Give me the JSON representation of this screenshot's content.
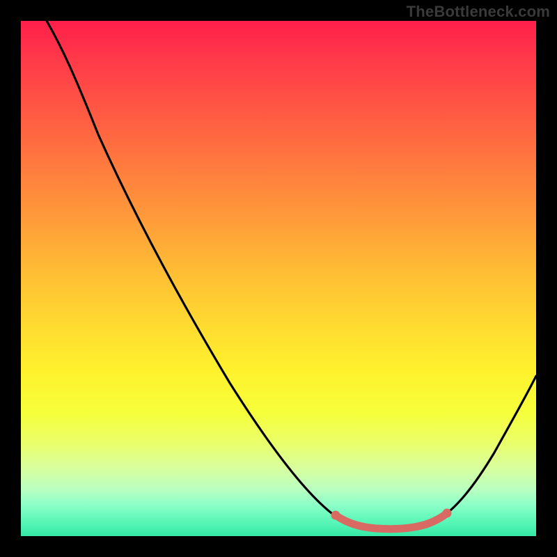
{
  "watermark": "TheBottleneck.com",
  "chart_data": {
    "type": "line",
    "title": "",
    "xlabel": "",
    "ylabel": "",
    "xlim": [
      0,
      100
    ],
    "ylim": [
      0,
      100
    ],
    "grid": false,
    "series": [
      {
        "name": "curve",
        "color": "#000000",
        "x": [
          5,
          10,
          15,
          20,
          25,
          30,
          35,
          40,
          45,
          50,
          55,
          60,
          63,
          66,
          70,
          74,
          78,
          81,
          83,
          86,
          90,
          95,
          100
        ],
        "y": [
          100,
          94,
          86,
          78,
          70,
          62,
          54,
          46,
          38,
          30,
          22,
          14,
          9,
          5.5,
          3,
          2,
          2,
          2.3,
          3,
          5,
          10,
          18,
          27
        ]
      },
      {
        "name": "highlight",
        "color": "#d86a63",
        "x": [
          63,
          65,
          67,
          69,
          71,
          73,
          75,
          77,
          79,
          81,
          83
        ],
        "y": [
          3.2,
          2.6,
          2.2,
          2.0,
          2.0,
          2.0,
          2.0,
          2.1,
          2.3,
          2.6,
          3.2
        ]
      }
    ],
    "gradient_stops": [
      {
        "pos": 0.0,
        "color": "#ff1f4b"
      },
      {
        "pos": 0.5,
        "color": "#ffbb35"
      },
      {
        "pos": 0.72,
        "color": "#fff22d"
      },
      {
        "pos": 0.9,
        "color": "#b8ffc0"
      },
      {
        "pos": 1.0,
        "color": "#36e9a6"
      }
    ]
  }
}
